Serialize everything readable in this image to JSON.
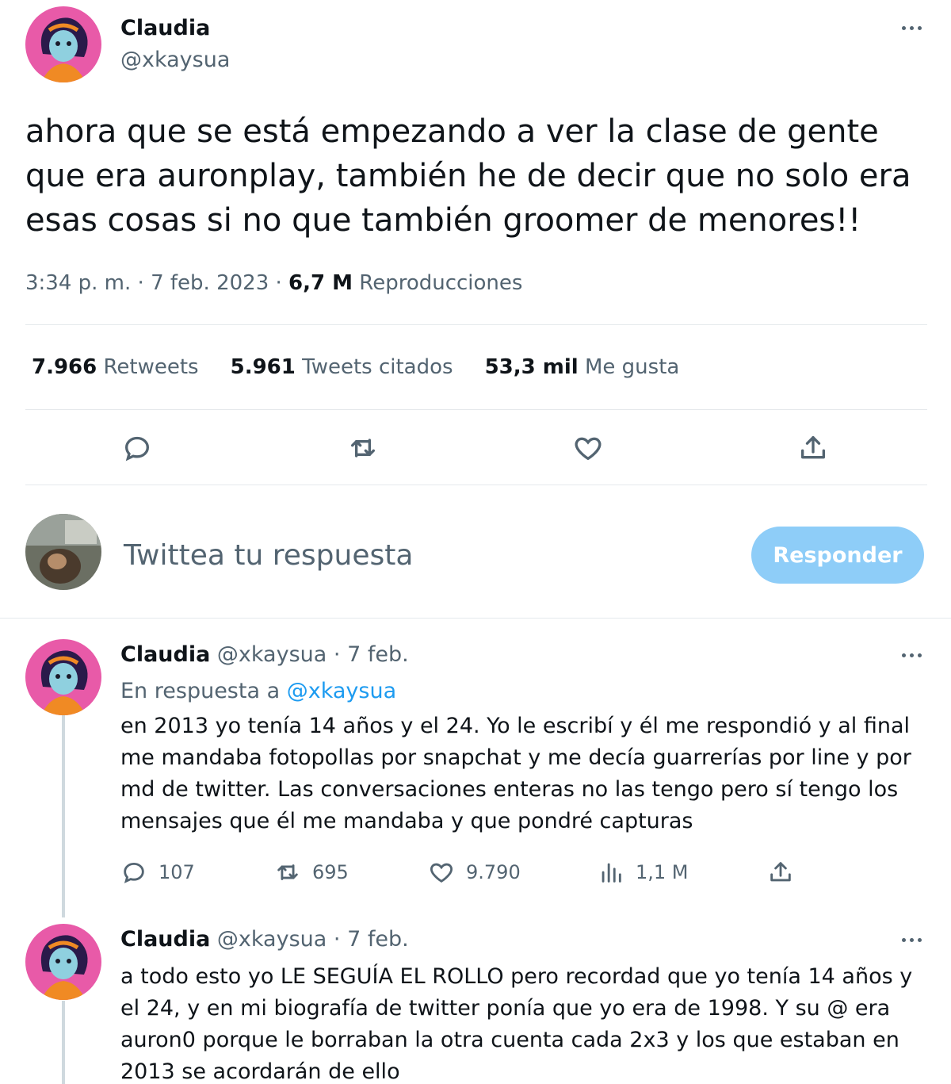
{
  "main_tweet": {
    "author_name": "Claudia",
    "author_handle": "@xkaysua",
    "text": "ahora que se está empezando a ver la clase de gente que era auronplay, también he de decir que no solo era esas cosas si no que también groomer de menores!!",
    "time": "3:34 p. m.",
    "date": "7 feb. 2023",
    "views_count": "6,7 M",
    "views_label": "Reproducciones",
    "retweets_count": "7.966",
    "retweets_label": "Retweets",
    "quotes_count": "5.961",
    "quotes_label": "Tweets citados",
    "likes_count": "53,3 mil",
    "likes_label": "Me gusta"
  },
  "reply_box": {
    "placeholder": "Twittea tu respuesta",
    "button_label": "Responder"
  },
  "replies": [
    {
      "author_name": "Claudia",
      "author_handle": "@xkaysua",
      "date": "7 feb.",
      "reply_to_prefix": "En respuesta a",
      "reply_to_handle": "@xkaysua",
      "text": "en 2013 yo tenía 14 años y el 24. Yo le escribí y él me respondió y al final me mandaba fotopollas por snapchat y me decía guarrerías por line y por md de twitter. Las conversaciones enteras no las tengo pero sí tengo los mensajes que él me mandaba y que pondré capturas",
      "replies_count": "107",
      "retweets_count": "695",
      "likes_count": "9.790",
      "views_count": "1,1 M"
    },
    {
      "author_name": "Claudia",
      "author_handle": "@xkaysua",
      "date": "7 feb.",
      "text": "a todo esto yo LE SEGUÍA EL ROLLO pero recordad que yo tenía 14 años y el 24, y en mi biografía de twitter ponía que yo era de 1998. Y su @ era auron0 porque le borraban la otra cuenta cada 2x3 y los que estaban en 2013 se acordarán de ello"
    }
  ],
  "colors": {
    "text": "#0f1419",
    "muted": "#536471",
    "link": "#1d9bf0",
    "button_disabled": "#8ecdf8",
    "avatar_bg": "#e85aa8"
  },
  "icons": [
    "more-icon",
    "reply-icon",
    "retweet-icon",
    "like-icon",
    "share-icon",
    "views-icon"
  ]
}
